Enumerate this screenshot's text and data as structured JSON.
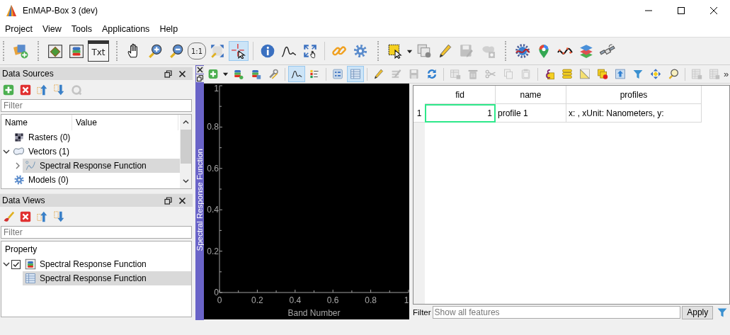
{
  "window": {
    "title": "EnMAP-Box 3 (dev)"
  },
  "menu": [
    "Project",
    "View",
    "Tools",
    "Applications",
    "Help"
  ],
  "main_toolbar": {
    "groups": [
      [
        {
          "kind": "add-data",
          "selected": false,
          "disabled": false
        }
      ],
      [
        {
          "kind": "map-window",
          "selected": false,
          "disabled": false
        },
        {
          "kind": "db-window",
          "selected": false,
          "disabled": false
        },
        {
          "kind": "text-window",
          "label": "Txt",
          "selected": false,
          "disabled": false
        }
      ],
      [
        {
          "kind": "pan",
          "selected": false,
          "disabled": false
        },
        {
          "kind": "zoom-in",
          "selected": false,
          "disabled": false
        },
        {
          "kind": "zoom-out",
          "selected": false,
          "disabled": false
        },
        {
          "kind": "zoom-actual",
          "label": "1:1",
          "selected": false,
          "disabled": false
        },
        {
          "kind": "zoom-full",
          "selected": false,
          "disabled": false
        },
        {
          "kind": "crosshair",
          "selected": true,
          "disabled": false
        },
        {
          "kind": "sep"
        },
        {
          "kind": "info",
          "selected": false,
          "disabled": false
        },
        {
          "kind": "profile",
          "selected": false,
          "disabled": false
        },
        {
          "kind": "zoom-pixel",
          "selected": false,
          "disabled": false
        },
        {
          "kind": "sep"
        },
        {
          "kind": "link",
          "selected": false,
          "disabled": false
        },
        {
          "kind": "gear",
          "selected": false,
          "disabled": false
        }
      ],
      [
        {
          "kind": "select-rect",
          "dropdown": true,
          "selected": false,
          "disabled": false
        },
        {
          "kind": "deselect",
          "selected": false,
          "disabled": false
        },
        {
          "kind": "pencil",
          "selected": false,
          "disabled": false
        },
        {
          "kind": "save-edit",
          "selected": false,
          "disabled": true
        },
        {
          "kind": "blob-gear",
          "selected": false,
          "disabled": true
        }
      ],
      [
        {
          "kind": "globe-gear",
          "selected": false,
          "disabled": false
        },
        {
          "kind": "map-pin",
          "selected": false,
          "disabled": false
        },
        {
          "kind": "wave",
          "selected": false,
          "disabled": false
        },
        {
          "kind": "layer-stack",
          "selected": false,
          "disabled": false
        },
        {
          "kind": "satellite",
          "selected": false,
          "disabled": false
        }
      ]
    ]
  },
  "data_sources": {
    "title": "Data Sources",
    "toolbar": [
      {
        "kind": "add",
        "disabled": false
      },
      {
        "kind": "remove",
        "disabled": false
      },
      {
        "kind": "collapse",
        "disabled": false
      },
      {
        "kind": "expand",
        "disabled": false
      },
      {
        "kind": "reload",
        "disabled": true
      }
    ],
    "filter": {
      "placeholder": "Filter"
    },
    "columns": [
      "Name",
      "Value"
    ],
    "items": [
      {
        "label": "Rasters (0)",
        "kind": "raster",
        "selected": false
      },
      {
        "label": "Vectors (1)",
        "kind": "vector",
        "expanded": true,
        "selected": false,
        "children": [
          {
            "label": "Spectral Response Function",
            "kind": "spectral",
            "expanded": false,
            "selected": true
          }
        ]
      },
      {
        "label": "Models (0)",
        "kind": "models",
        "selected": false
      }
    ]
  },
  "data_views": {
    "title": "Data Views",
    "toolbar": [
      {
        "kind": "brush",
        "disabled": false
      },
      {
        "kind": "remove",
        "disabled": false
      },
      {
        "kind": "collapse",
        "disabled": false
      },
      {
        "kind": "expand",
        "disabled": false
      }
    ],
    "filter": {
      "placeholder": "Filter"
    },
    "columns": [
      "Property"
    ],
    "items": [
      {
        "label": "Spectral Response Function",
        "kind": "speclib",
        "expanded": true,
        "checked": true,
        "selected": false,
        "children": [
          {
            "label": "Spectral Response Function",
            "kind": "table",
            "selected": true
          }
        ]
      }
    ]
  },
  "spectral_library": {
    "title": "Spectral Response Function",
    "toolbar": [
      {
        "kind": "add",
        "dropdown": true,
        "selected": false,
        "disabled": false
      },
      {
        "kind": "db-add",
        "selected": false,
        "disabled": false
      },
      {
        "kind": "db-save",
        "selected": false,
        "disabled": false
      },
      {
        "kind": "wrench",
        "selected": false,
        "disabled": false
      },
      {
        "kind": "sep"
      },
      {
        "kind": "profile",
        "selected": true,
        "disabled": false
      },
      {
        "kind": "legend",
        "selected": false,
        "disabled": false
      },
      {
        "kind": "sep"
      },
      {
        "kind": "form",
        "selected": false,
        "disabled": false
      },
      {
        "kind": "table",
        "selected": true,
        "disabled": false
      },
      {
        "kind": "sep"
      },
      {
        "kind": "pencil",
        "selected": false,
        "disabled": false
      },
      {
        "kind": "multi-edit",
        "selected": false,
        "disabled": true
      },
      {
        "kind": "save",
        "selected": false,
        "disabled": true
      },
      {
        "kind": "refresh",
        "selected": false,
        "disabled": false
      },
      {
        "kind": "sep"
      },
      {
        "kind": "delete-col",
        "selected": false,
        "disabled": true
      },
      {
        "kind": "trash",
        "selected": false,
        "disabled": true
      },
      {
        "kind": "scissors",
        "selected": false,
        "disabled": true
      },
      {
        "kind": "copy",
        "selected": false,
        "disabled": true
      },
      {
        "kind": "paste",
        "selected": false,
        "disabled": true
      },
      {
        "kind": "sep"
      },
      {
        "kind": "expression",
        "selected": false,
        "disabled": false
      },
      {
        "kind": "rows",
        "selected": false,
        "disabled": false
      },
      {
        "kind": "invert",
        "selected": false,
        "disabled": false
      },
      {
        "kind": "deselect-y",
        "selected": false,
        "disabled": false
      },
      {
        "kind": "move-top",
        "selected": false,
        "disabled": false
      },
      {
        "kind": "filter",
        "selected": false,
        "disabled": false
      },
      {
        "kind": "pan-sel",
        "selected": false,
        "disabled": false
      },
      {
        "kind": "zoom-sel",
        "selected": false,
        "disabled": false
      },
      {
        "kind": "sep"
      },
      {
        "kind": "table-x",
        "selected": false,
        "disabled": true
      },
      {
        "kind": "table-x",
        "selected": false,
        "disabled": true
      }
    ],
    "overflow": "»",
    "chart_data": {
      "type": "line",
      "xlabel": "Band Number",
      "xlim": [
        0,
        1
      ],
      "ylim": [
        0,
        1
      ],
      "xticks": [
        0,
        0.2,
        0.4,
        0.6,
        0.8,
        1
      ],
      "yticks": [
        0,
        0.2,
        0.4,
        0.6,
        0.8,
        1
      ]
    },
    "table": {
      "columns": [
        {
          "label": "fid",
          "kind": "number"
        },
        {
          "label": "name",
          "kind": "text"
        },
        {
          "label": "profiles",
          "kind": "text"
        }
      ],
      "rows": [
        {
          "header": "1",
          "cells": [
            {
              "text": "1",
              "current": true
            },
            {
              "text": "profile 1",
              "current": false
            },
            {
              "text": "x: , xUnit: Nanometers, y:",
              "current": false
            }
          ]
        }
      ]
    },
    "filter": {
      "label": "Filter",
      "placeholder": "Show all features",
      "button": "Apply"
    }
  }
}
